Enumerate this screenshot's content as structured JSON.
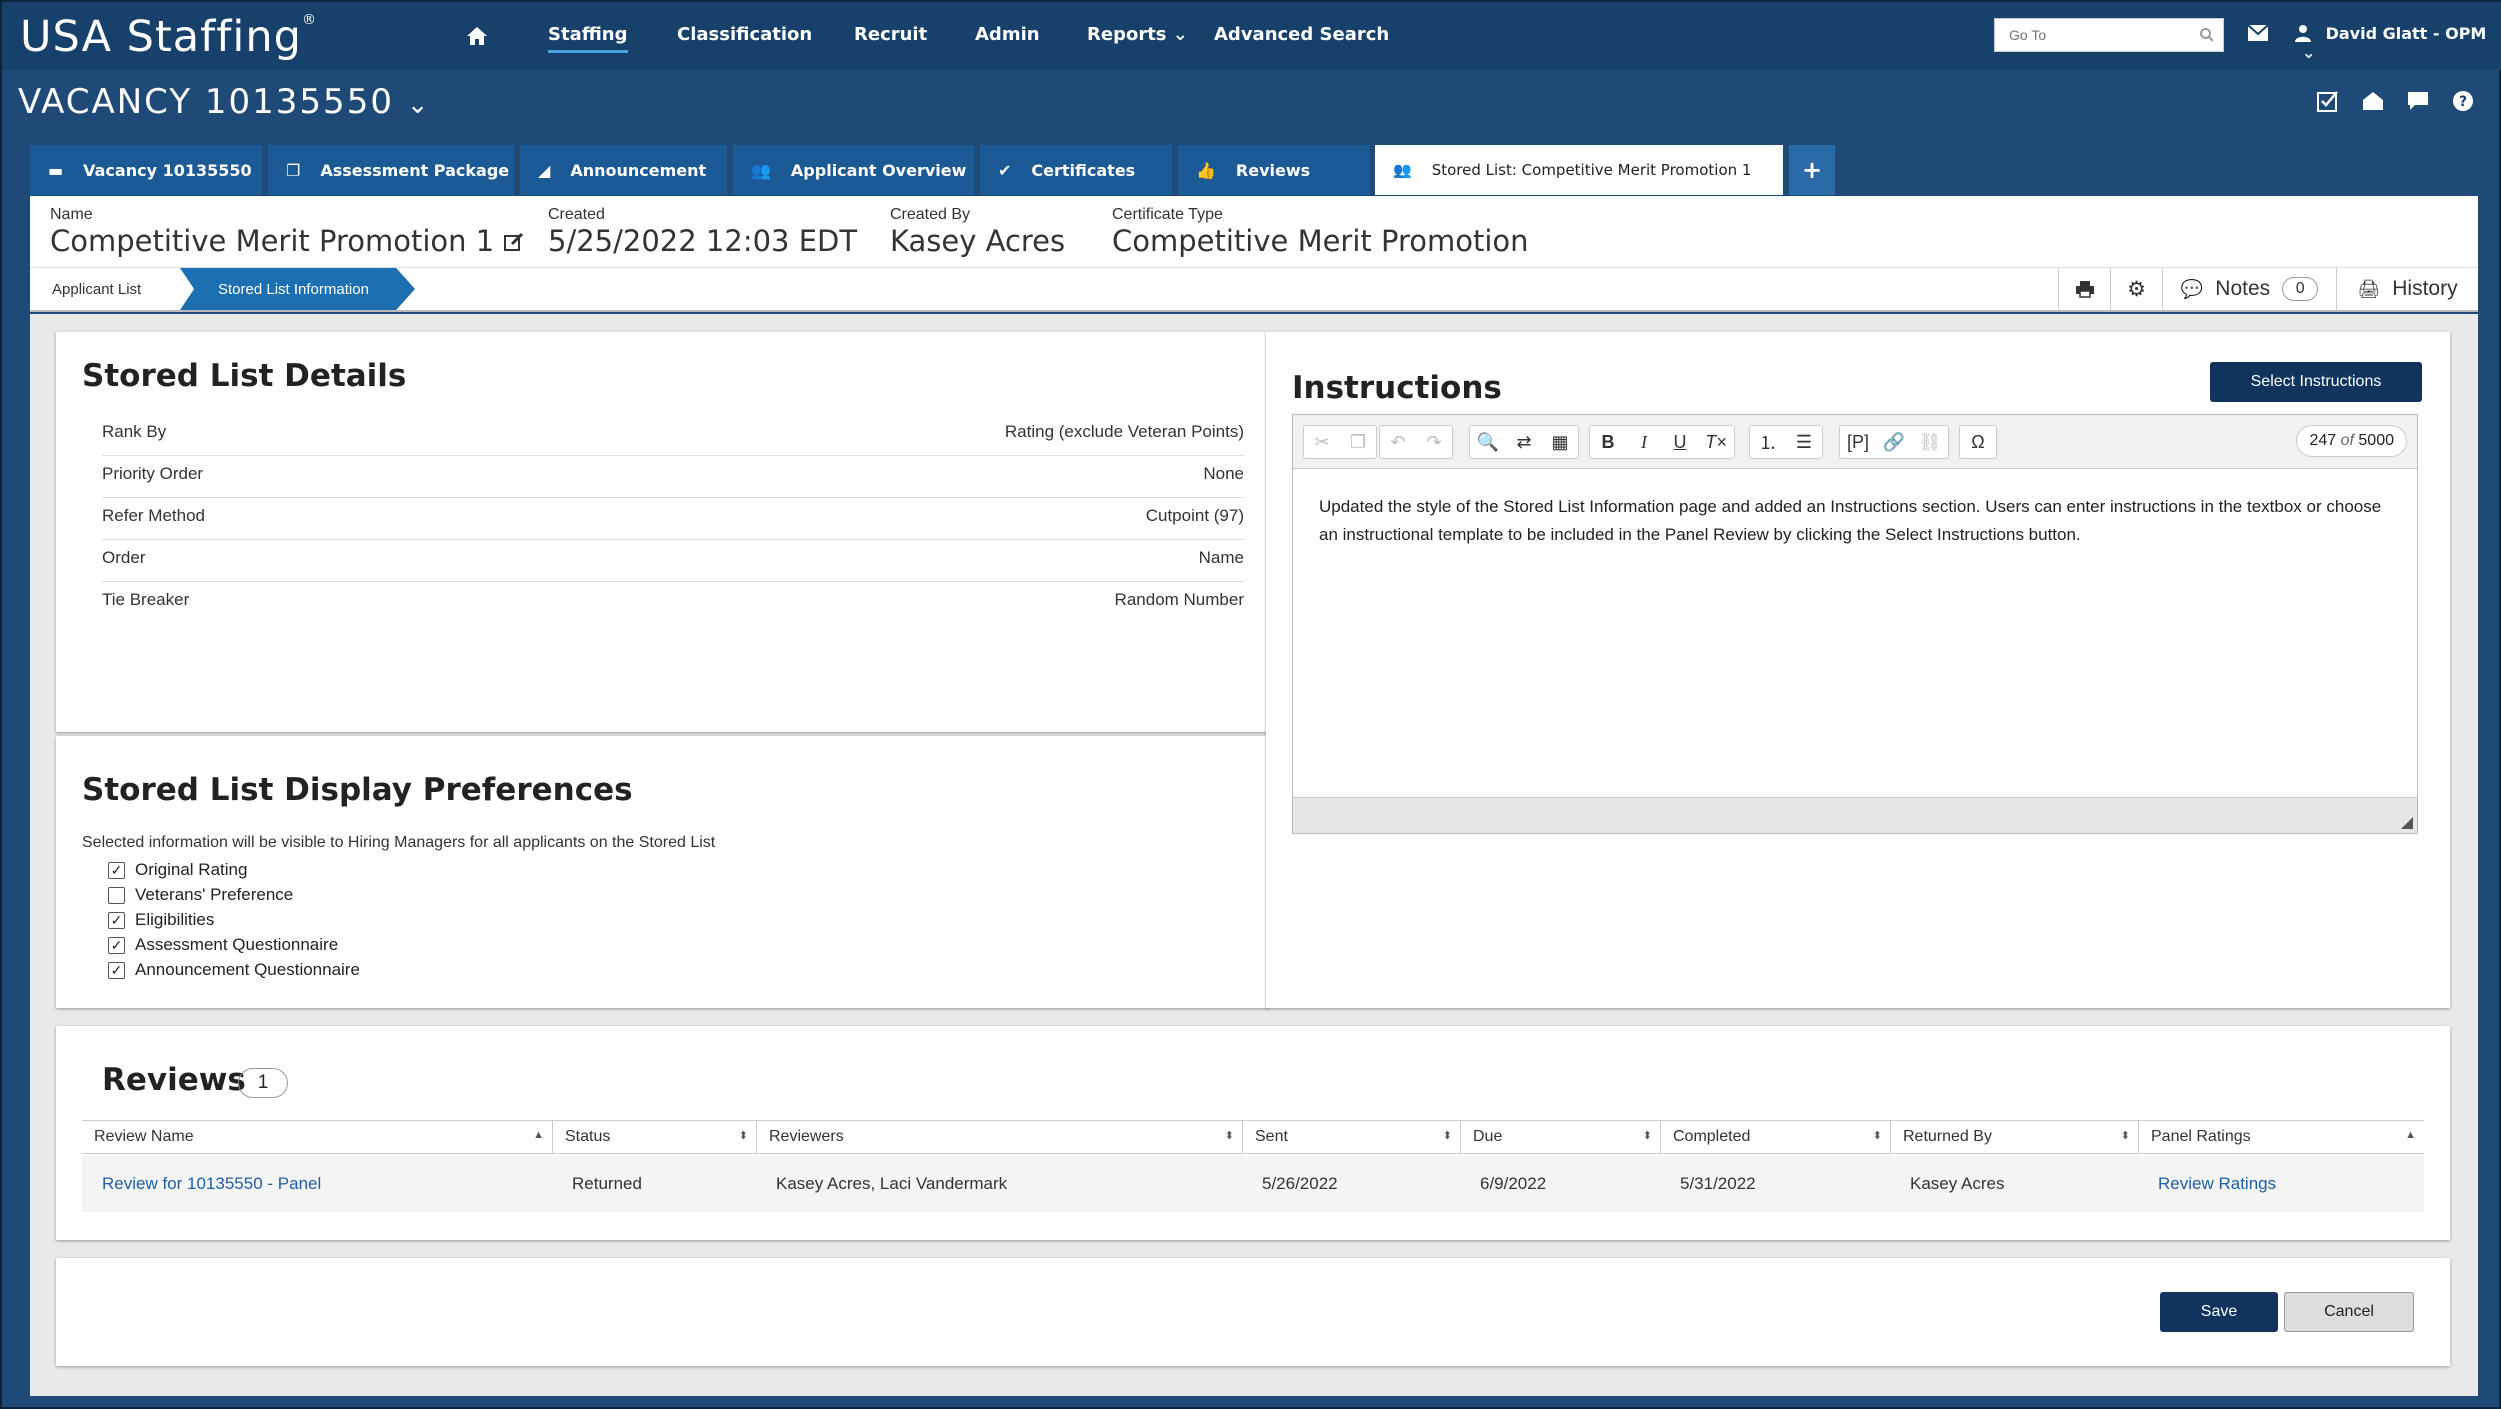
{
  "app": {
    "brand": "USA Staffing",
    "brand_mark": "®"
  },
  "nav": {
    "items": [
      "Staffing",
      "Classification",
      "Recruit",
      "Admin",
      "Reports",
      "Advanced Search"
    ],
    "goto_placeholder": "Go To",
    "user": "David Glatt - OPM"
  },
  "vacancy": {
    "title": "VACANCY 10135550"
  },
  "tabs": [
    "Vacancy 10135550",
    "Assessment Package",
    "Announcement",
    "Applicant Overview",
    "Certificates",
    "Reviews",
    "Stored List: Competitive Merit Promotion 1"
  ],
  "add_tab": "+",
  "info": {
    "name_label": "Name",
    "name_value": "Competitive Merit Promotion 1",
    "created_label": "Created",
    "created_value": "5/25/2022 12:03 EDT",
    "createdby_label": "Created By",
    "createdby_value": "Kasey Acres",
    "certtype_label": "Certificate Type",
    "certtype_value": "Competitive Merit Promotion"
  },
  "breadcrumb": {
    "first": "Applicant List",
    "current": "Stored List Information"
  },
  "tools": {
    "notes_label": "Notes",
    "notes_count": "0",
    "history_label": "History"
  },
  "details": {
    "title": "Stored List Details",
    "rows": [
      {
        "label": "Rank By",
        "value": "Rating (exclude Veteran Points)"
      },
      {
        "label": "Priority Order",
        "value": "None"
      },
      {
        "label": "Refer Method",
        "value": "Cutpoint (97)"
      },
      {
        "label": "Order",
        "value": "Name"
      },
      {
        "label": "Tie Breaker",
        "value": "Random Number"
      }
    ]
  },
  "prefs": {
    "title": "Stored List Display Preferences",
    "subtitle": "Selected information will be visible to Hiring Managers for all applicants on the Stored List",
    "options": [
      {
        "label": "Original Rating",
        "checked": true
      },
      {
        "label": "Veterans' Preference",
        "checked": false
      },
      {
        "label": "Eligibilities",
        "checked": true
      },
      {
        "label": "Assessment Questionnaire",
        "checked": true
      },
      {
        "label": "Announcement Questionnaire",
        "checked": true
      }
    ]
  },
  "instructions": {
    "title": "Instructions",
    "select_button": "Select Instructions",
    "char_count": "247",
    "char_of": "of",
    "char_max": "5000",
    "text": "Updated the style of the Stored List Information page and added an Instructions section. Users can enter instructions in the textbox or choose an instructional template to be included in the Panel Review by clicking the Select Instructions button."
  },
  "reviews": {
    "title": "Reviews",
    "count": "1",
    "columns": [
      "Review Name",
      "Status",
      "Reviewers",
      "Sent",
      "Due",
      "Completed",
      "Returned By",
      "Panel Ratings"
    ],
    "rows": [
      [
        "Review for 10135550 - Panel",
        "Returned",
        "Kasey Acres, Laci Vandermark",
        "5/26/2022",
        "6/9/2022",
        "5/31/2022",
        "Kasey Acres",
        "Review Ratings"
      ]
    ]
  },
  "footer": {
    "save": "Save",
    "cancel": "Cancel"
  },
  "colors": {
    "nav_bg": "#17406b",
    "tab_bg": "#1c5a95",
    "accent": "#1c6fb0",
    "primary_button": "#10345e",
    "link": "#1c5fa5"
  }
}
